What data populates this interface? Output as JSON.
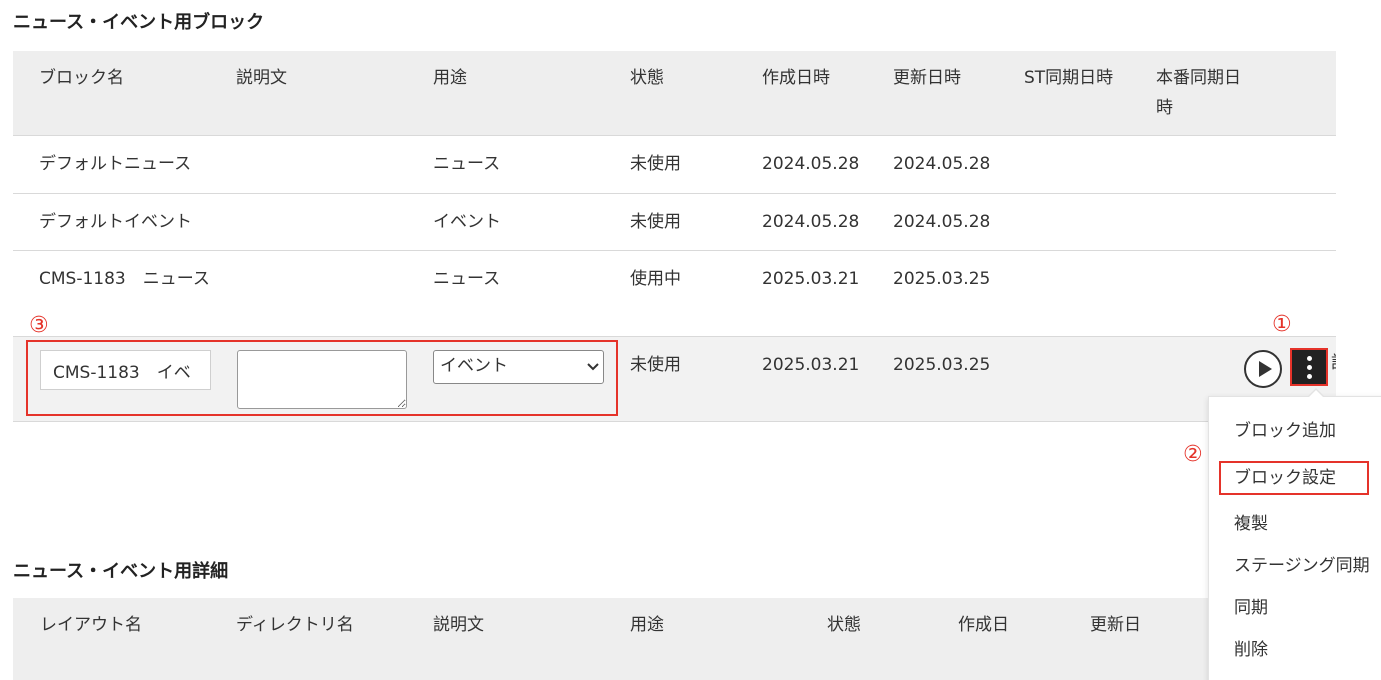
{
  "section1": {
    "title": "ニュース・イベント用ブロック",
    "headers": [
      "ブロック名",
      "説明文",
      "用途",
      "状態",
      "作成日時",
      "更新日時",
      "ST同期日時",
      "本番同期日時"
    ],
    "rows": [
      {
        "name": "デフォルトニュース",
        "desc": "",
        "usage": "ニュース",
        "status": "未使用",
        "created": "2024.05.28",
        "updated": "2024.05.28"
      },
      {
        "name": "デフォルトイベント",
        "desc": "",
        "usage": "イベント",
        "status": "未使用",
        "created": "2024.05.28",
        "updated": "2024.05.28"
      },
      {
        "name": "CMS-1183　ニュース",
        "desc": "",
        "usage": "ニュース",
        "status": "使用中",
        "created": "2025.03.21",
        "updated": "2025.03.25"
      }
    ],
    "edit_row": {
      "name_value": "CMS-1183　イベ",
      "desc_value": "",
      "usage_selected": "イベント",
      "status": "未使用",
      "created": "2025.03.21",
      "updated": "2025.03.25",
      "clipped_label": "設"
    }
  },
  "annotations": {
    "n1": "①",
    "n2": "②",
    "n3": "③"
  },
  "menu": {
    "items": [
      "ブロック追加",
      "ブロック設定",
      "複製",
      "ステージング同期",
      "同期",
      "削除"
    ]
  },
  "section2": {
    "title": "ニュース・イベント用詳細",
    "headers": [
      "レイアウト名",
      "ディレクトリ名",
      "説明文",
      "用途",
      "状態",
      "作成日",
      "更新日"
    ]
  },
  "colors": {
    "highlight": "#e5332a",
    "header_bg": "#eeeeee",
    "edit_row_bg": "#f2f2f2"
  },
  "icons": {
    "play": "play-circle-icon",
    "more": "vertical-ellipsis-icon",
    "dropdown": "chevron-down-icon"
  }
}
